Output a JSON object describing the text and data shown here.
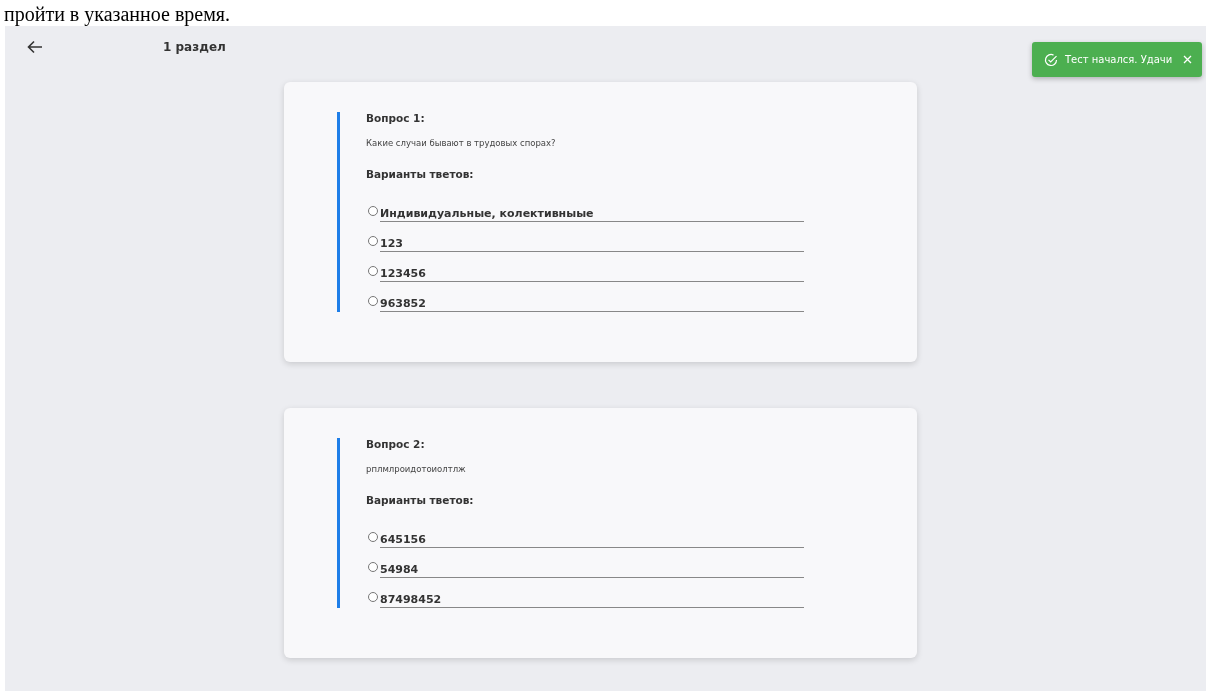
{
  "document_text": "пройти в указанное время.",
  "header": {
    "title": "1 раздел"
  },
  "toast": {
    "message": "Тест начался. Удачи"
  },
  "questions": [
    {
      "title": "Вопрос 1:",
      "text": "Какие случаи бывают в трудовых спорах?",
      "options_label": "Варианты тветов:",
      "options": [
        {
          "label": "Индивидуальные, колективныые",
          "selected": false
        },
        {
          "label": "123",
          "selected": false
        },
        {
          "label": "123456",
          "selected": false
        },
        {
          "label": "963852",
          "selected": false
        }
      ]
    },
    {
      "title": "Вопрос 2:",
      "text": "рплмлроидотоиолтлж",
      "options_label": "Варианты тветов:",
      "options": [
        {
          "label": "645156",
          "selected": false
        },
        {
          "label": "54984",
          "selected": false
        },
        {
          "label": "87498452",
          "selected": false
        }
      ]
    }
  ]
}
